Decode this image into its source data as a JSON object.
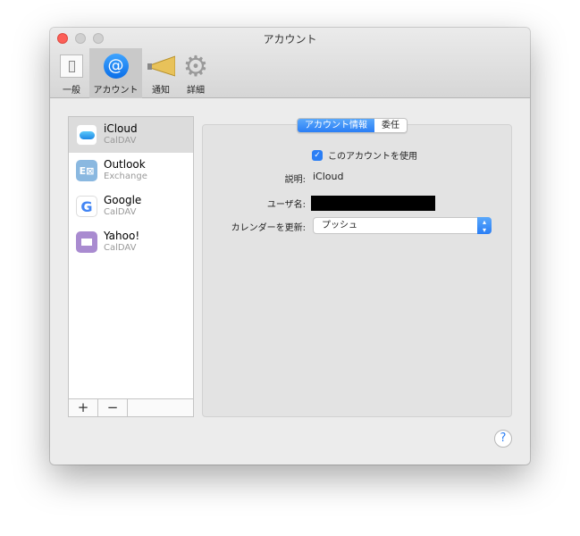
{
  "window": {
    "title": "アカウント"
  },
  "toolbar": [
    {
      "label": "一般",
      "icon": "switch-icon"
    },
    {
      "label": "アカウント",
      "icon": "at-icon"
    },
    {
      "label": "通知",
      "icon": "megaphone-icon"
    },
    {
      "label": "詳細",
      "icon": "gear-icon"
    }
  ],
  "accounts": [
    {
      "name": "iCloud",
      "type": "CalDAV"
    },
    {
      "name": "Outlook",
      "type": "Exchange"
    },
    {
      "name": "Google",
      "type": "CalDAV"
    },
    {
      "name": "Yahoo!",
      "type": "CalDAV"
    }
  ],
  "list_buttons": {
    "add": "+",
    "remove": "−"
  },
  "tabs": {
    "info": "アカウント情報",
    "delegation": "委任"
  },
  "form": {
    "enable_label": "このアカウントを使用",
    "description_label": "説明:",
    "description_value": "iCloud",
    "username_label": "ユーザ名:",
    "refresh_label": "カレンダーを更新:",
    "refresh_value": "プッシュ"
  },
  "help": "?",
  "colors": {
    "accent": "#2a7ef5"
  }
}
